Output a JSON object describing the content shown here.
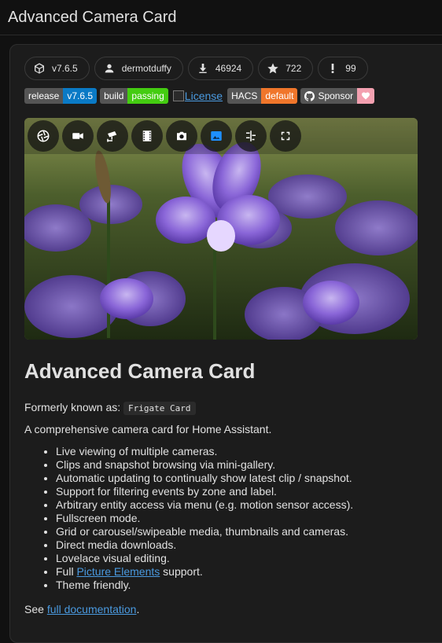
{
  "page": {
    "title": "Advanced Camera Card"
  },
  "chips": [
    {
      "icon": "cube-icon",
      "label": "v7.6.5"
    },
    {
      "icon": "user-icon",
      "label": "dermotduffy"
    },
    {
      "icon": "download-icon",
      "label": "46924"
    },
    {
      "icon": "star-icon",
      "label": "722"
    },
    {
      "icon": "exclamation-icon",
      "label": "99"
    }
  ],
  "badges": {
    "release": {
      "left": "release",
      "right": "v7.6.5",
      "color": "#0a7ac6"
    },
    "build": {
      "left": "build",
      "right": "passing",
      "color": "#44cc11"
    },
    "license_alt": "License",
    "hacs": {
      "left": "HACS",
      "right": "default",
      "color": "#f0762b"
    },
    "sponsor": {
      "left": "Sponsor",
      "color": "#f3a0b0"
    }
  },
  "toolbar": {
    "buttons": [
      {
        "name": "aperture-icon"
      },
      {
        "name": "video-camera-icon"
      },
      {
        "name": "cctv-icon"
      },
      {
        "name": "film-icon"
      },
      {
        "name": "camera-icon"
      },
      {
        "name": "image-icon",
        "active": true
      },
      {
        "name": "timeline-icon"
      },
      {
        "name": "fullscreen-icon"
      }
    ],
    "active_color": "#1e90ff"
  },
  "content": {
    "heading": "Advanced Camera Card",
    "formerly_prefix": "Formerly known as:",
    "formerly_code": "Frigate Card",
    "description": "A comprehensive camera card for Home Assistant.",
    "features": [
      "Live viewing of multiple cameras.",
      "Clips and snapshot browsing via mini-gallery.",
      "Automatic updating to continually show latest clip / snapshot.",
      "Support for filtering events by zone and label.",
      "Arbitrary entity access via menu (e.g. motion sensor access).",
      "Fullscreen mode.",
      "Grid or carousel/swipeable media, thumbnails and cameras.",
      "Direct media downloads.",
      "Lovelace visual editing."
    ],
    "feature_pe_prefix": "Full",
    "feature_pe_link": "Picture Elements",
    "feature_pe_suffix": "support.",
    "feature_last": "Theme friendly.",
    "see_prefix": "See",
    "see_link": "full documentation",
    "see_suffix": "."
  }
}
